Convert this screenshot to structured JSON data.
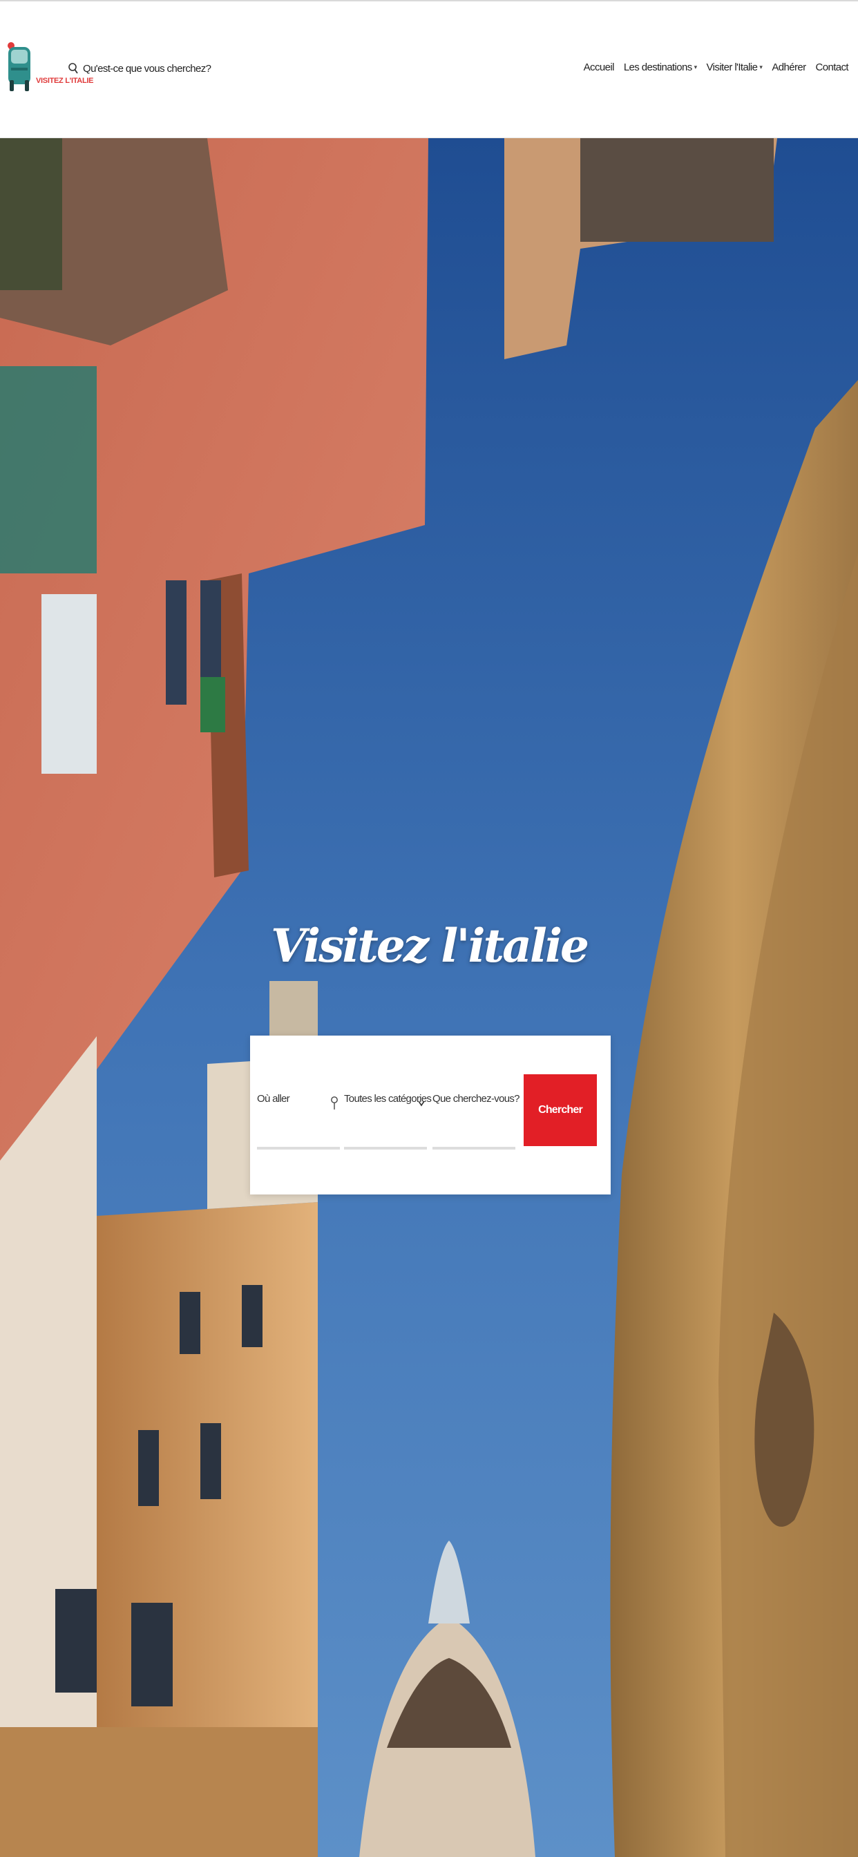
{
  "brand": {
    "logo_text": "VISITEZ L'ITALIE"
  },
  "header": {
    "search_label": "Qu'est-ce que vous cherchez?"
  },
  "nav": {
    "items": [
      {
        "label": "Accueil",
        "caret": ""
      },
      {
        "label": "Les destinations",
        "caret": "▾"
      },
      {
        "label": "Visiter l'Italie",
        "caret": "▾"
      },
      {
        "label": "Adhérer",
        "caret": ""
      },
      {
        "label": "Contact",
        "caret": ""
      }
    ]
  },
  "hero": {
    "title": "Visitez l'italie"
  },
  "search_form": {
    "where_placeholder": "Où aller",
    "category_value": "Toutes les catégories",
    "what_placeholder": "Que cherchez-vous?",
    "submit_label": "Chercher"
  },
  "colors": {
    "accent": "#e21f26",
    "logo_car": "#2f8f8c",
    "sky": "#3d6aa5"
  }
}
